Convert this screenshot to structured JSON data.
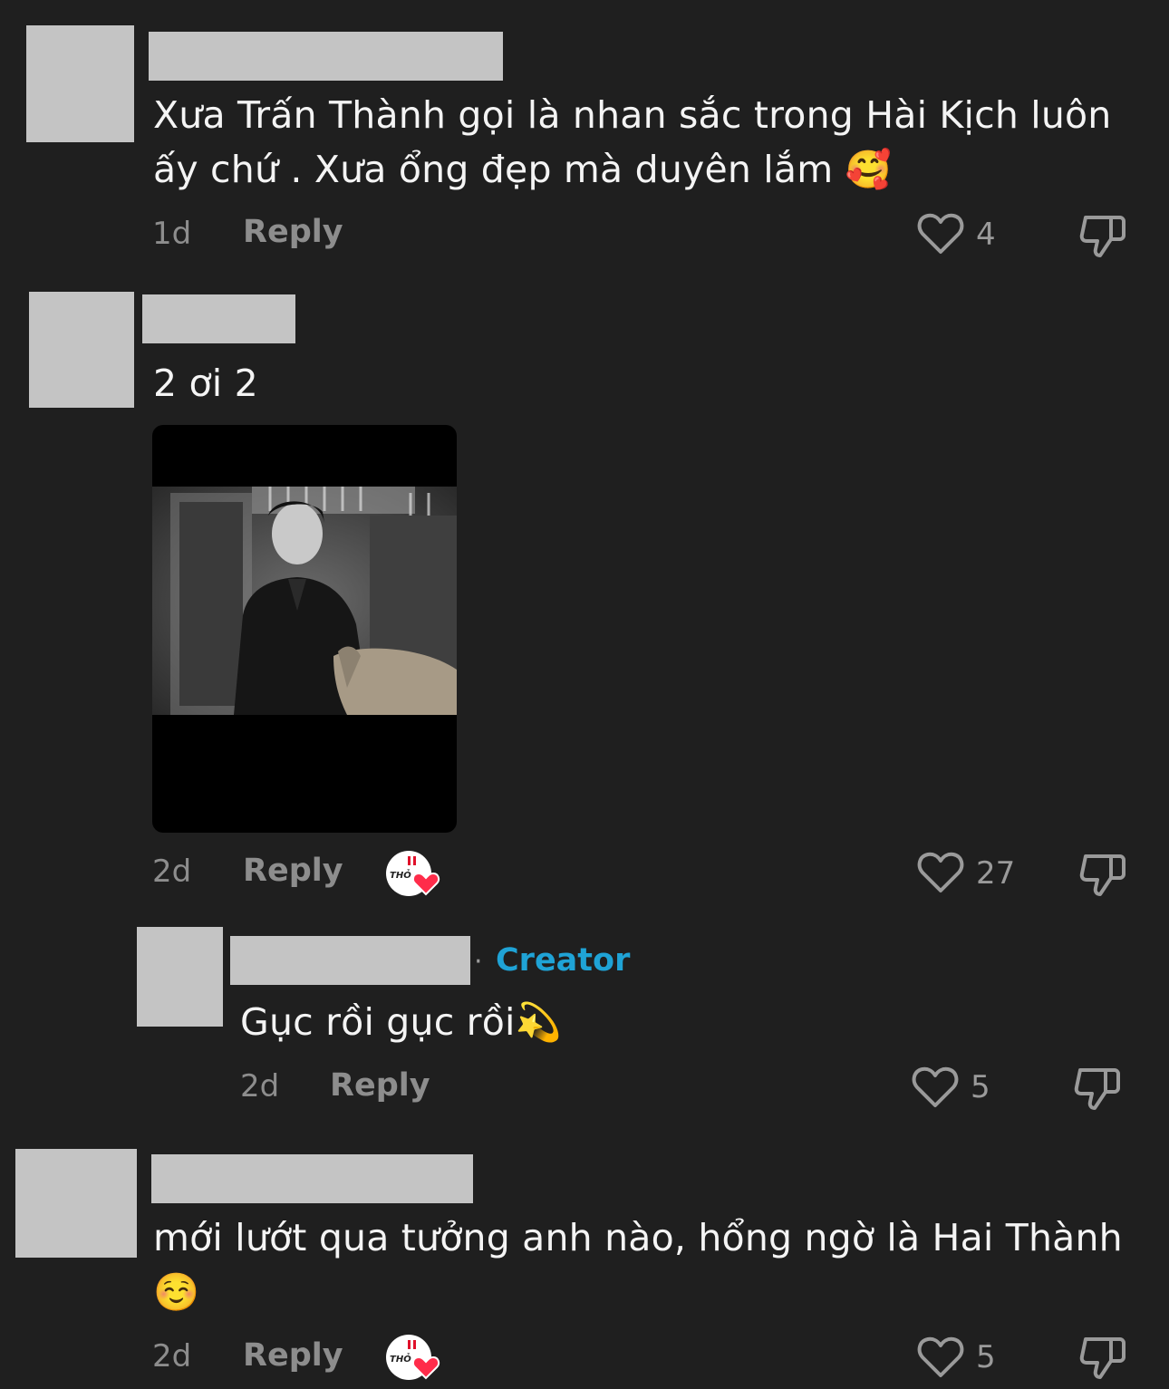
{
  "comments": [
    {
      "text_line1": "Xưa Trấn Thành gọi là nhan sắc trong Hài Kịch luôn",
      "text_line2": "ấy chứ . Xưa ổng đẹp mà duyên lắm 🥰",
      "age": "1d",
      "reply_label": "Reply",
      "likes": "4"
    },
    {
      "text": "2 ơi 2",
      "age": "2d",
      "reply_label": "Reply",
      "likes": "27",
      "badge_text": "THỎ"
    },
    {
      "creator_separator": "·",
      "creator_label": "Creator",
      "text": "Gục rồi gục rồi💫",
      "age": "2d",
      "reply_label": "Reply",
      "likes": "5"
    },
    {
      "text_line1": "mới lướt qua tưởng anh nào, hổng ngờ là Hai Thành",
      "text_line2": "☺️",
      "age": "2d",
      "reply_label": "Reply",
      "likes": "5",
      "badge_text": "THỎ"
    }
  ],
  "icons": {
    "like": "heart-outline-icon",
    "dislike": "thumbs-down-icon",
    "badge": "creator-liked-badge-icon"
  },
  "colors": {
    "background": "#1f1f1f",
    "creator": "#1fa3d6",
    "placeholder": "#c4c4c4"
  }
}
